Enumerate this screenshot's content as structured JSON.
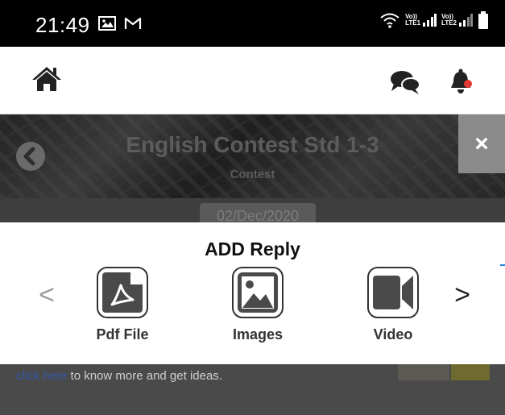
{
  "status_bar": {
    "time": "21:49",
    "left_icons": [
      "gallery-icon",
      "gmail-icon"
    ],
    "right_icons": [
      "wifi-icon",
      "volte-lte1-signal-icon",
      "volte-lte2-signal-icon",
      "battery-icon"
    ],
    "sim1_label_top": "Vo))",
    "sim1_label_bottom": "LTE1",
    "sim2_label_top": "Vo))",
    "sim2_label_bottom": "LTE2"
  },
  "header": {
    "icons": [
      "home-icon",
      "chat-icon",
      "bell-icon"
    ],
    "notification_dot_color": "#e53935"
  },
  "banner": {
    "title": "English Contest Std 1-3",
    "subtitle": "Contest",
    "close_label": "×",
    "date": "02/Dec/2020"
  },
  "modal": {
    "title": "ADD Reply",
    "prev_label": "<",
    "next_label": ">",
    "options": [
      {
        "label": "Pdf File",
        "icon": "pdf-file-icon"
      },
      {
        "label": "Images",
        "icon": "image-icon"
      },
      {
        "label": "Video",
        "icon": "video-icon"
      }
    ]
  },
  "background_text": {
    "link": "click here",
    "rest": " to know more and get ideas."
  }
}
